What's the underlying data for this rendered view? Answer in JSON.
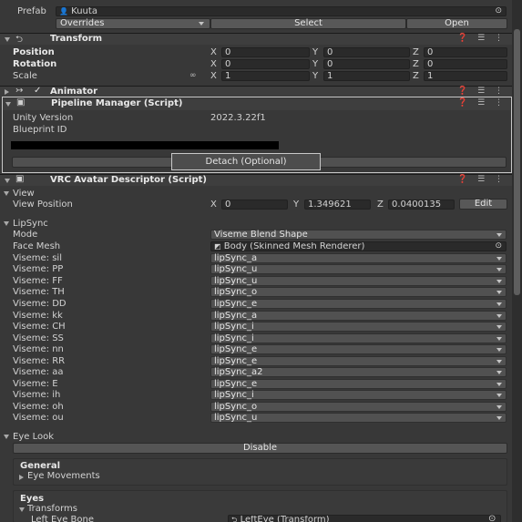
{
  "prefab": {
    "label": "Prefab",
    "value": "Kuuta"
  },
  "overrides": {
    "label": "Overrides",
    "select": "Select",
    "open": "Open"
  },
  "transform": {
    "title": "Transform",
    "position": {
      "label": "Position",
      "x": "0",
      "y": "0",
      "z": "0"
    },
    "rotation": {
      "label": "Rotation",
      "x": "0",
      "y": "0",
      "z": "0"
    },
    "scale": {
      "label": "Scale",
      "x": "1",
      "y": "1",
      "z": "1"
    }
  },
  "animator": {
    "title": "Animator"
  },
  "pipeline": {
    "title": "Pipeline Manager (Script)",
    "unity_version_label": "Unity Version",
    "unity_version_value": "2022.3.22f1",
    "blueprint_label": "Blueprint ID",
    "detach": "Detach (Optional)"
  },
  "descriptor": {
    "title": "VRC Avatar Descriptor (Script)",
    "view_label": "View",
    "view_position_label": "View Position",
    "x": "0",
    "y": "1.349621",
    "z": "0.0400135",
    "edit": "Edit",
    "lipsync_label": "LipSync",
    "mode_label": "Mode",
    "mode_value": "Viseme Blend Shape",
    "face_mesh_label": "Face Mesh",
    "face_mesh_value": "Body (Skinned Mesh Renderer)",
    "visemes": [
      {
        "label": "Viseme: sil",
        "value": "lipSync_a"
      },
      {
        "label": "Viseme: PP",
        "value": "lipSync_u"
      },
      {
        "label": "Viseme: FF",
        "value": "lipSync_u"
      },
      {
        "label": "Viseme: TH",
        "value": "lipSync_o"
      },
      {
        "label": "Viseme: DD",
        "value": "lipSync_e"
      },
      {
        "label": "Viseme: kk",
        "value": "lipSync_a"
      },
      {
        "label": "Viseme: CH",
        "value": "lipSync_i"
      },
      {
        "label": "Viseme: SS",
        "value": "lipSync_i"
      },
      {
        "label": "Viseme: nn",
        "value": "lipSync_e"
      },
      {
        "label": "Viseme: RR",
        "value": "lipSync_e"
      },
      {
        "label": "Viseme: aa",
        "value": "lipSync_a2"
      },
      {
        "label": "Viseme: E",
        "value": "lipSync_e"
      },
      {
        "label": "Viseme: ih",
        "value": "lipSync_i"
      },
      {
        "label": "Viseme: oh",
        "value": "lipSync_o"
      },
      {
        "label": "Viseme: ou",
        "value": "lipSync_u"
      }
    ],
    "eye_look_label": "Eye Look",
    "disable": "Disable",
    "general_label": "General",
    "eye_movements_label": "Eye Movements",
    "eyes_label": "Eyes",
    "transforms_label": "Transforms",
    "left_eye_bone_label": "Left Eye Bone",
    "left_eye_bone_value": "LeftEye (Transform)"
  },
  "colors": {
    "background": "#383838",
    "field": "#2a2a2a",
    "dropdown": "#515151",
    "highlight_border": "#c8c8c8"
  }
}
